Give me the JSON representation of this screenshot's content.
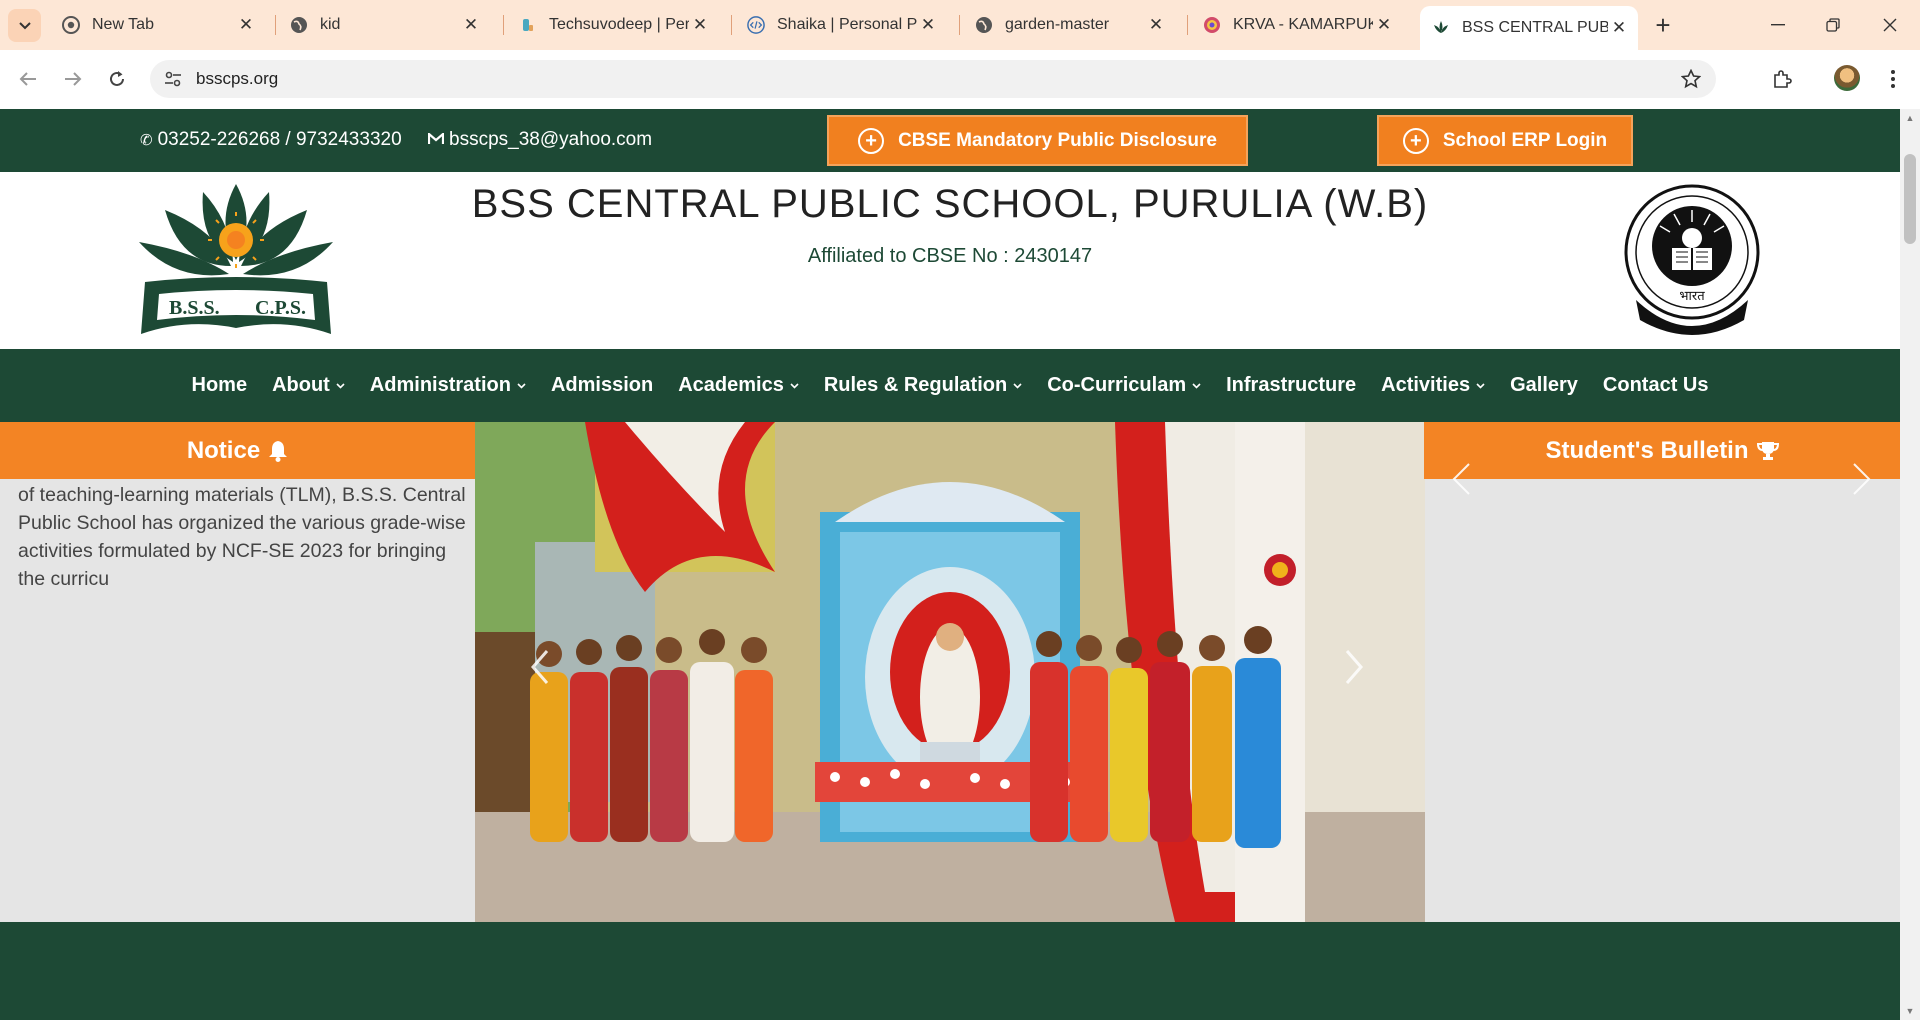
{
  "browser": {
    "tabs": [
      {
        "title": "New Tab",
        "icon": "chrome-icon"
      },
      {
        "title": "kid",
        "icon": "globe-icon"
      },
      {
        "title": "Techsuvodeep | Perso",
        "icon": "site-icon"
      },
      {
        "title": "Shaika | Personal Pro",
        "icon": "code-icon"
      },
      {
        "title": "garden-master",
        "icon": "globe-icon"
      },
      {
        "title": "KRVA - KAMARPUKU",
        "icon": "site-icon"
      },
      {
        "title": "BSS CENTRAL PUBLIC",
        "icon": "lotus-icon",
        "active": true
      }
    ],
    "url": "bsscps.org"
  },
  "topbar": {
    "phone": "03252-226268 / 9732433320",
    "email": "bsscps_38@yahoo.com",
    "disclosure_button": "CBSE Mandatory Public Disclosure",
    "erp_button": "School ERP Login"
  },
  "header": {
    "title": "BSS CENTRAL PUBLIC SCHOOL, PURULIA (W.B)",
    "subtitle": "Affiliated to CBSE No : 2430147",
    "logo_text_left": "B.S.S.",
    "logo_text_right": "C.P.S.",
    "seal_text": "भारत"
  },
  "nav": {
    "items": [
      {
        "label": "Home",
        "dropdown": false
      },
      {
        "label": "About",
        "dropdown": true
      },
      {
        "label": "Administration",
        "dropdown": true
      },
      {
        "label": "Admission",
        "dropdown": false
      },
      {
        "label": "Academics",
        "dropdown": true
      },
      {
        "label": "Rules & Regulation",
        "dropdown": true
      },
      {
        "label": "Co-Curriculam",
        "dropdown": true
      },
      {
        "label": "Infrastructure",
        "dropdown": false
      },
      {
        "label": "Activities",
        "dropdown": true
      },
      {
        "label": "Gallery",
        "dropdown": false
      },
      {
        "label": "Contact Us",
        "dropdown": false
      }
    ]
  },
  "notice": {
    "heading": "Notice",
    "text": "of teaching-learning materials (TLM), B.S.S. Central Public School has organized the various grade-wise activities formulated by NCF-SE 2023 for bringing the curricu"
  },
  "bulletin": {
    "heading": "Student's Bulletin"
  },
  "colors": {
    "brand_green": "#1d4935",
    "accent_orange": "#f38424",
    "panel_grey": "#e5e5e5"
  }
}
